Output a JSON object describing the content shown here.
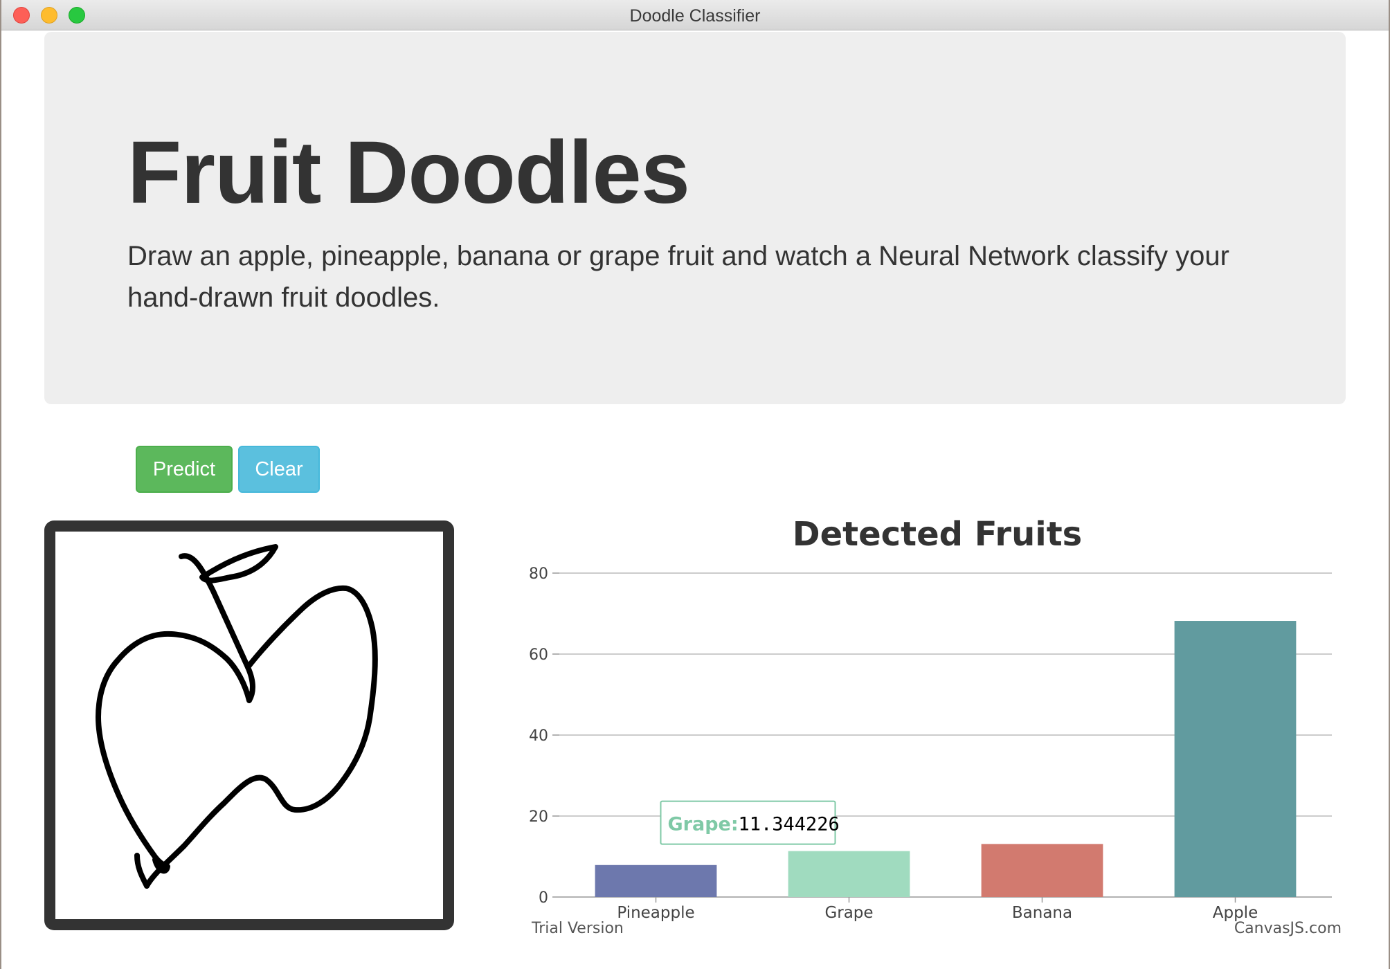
{
  "window": {
    "title": "Doodle Classifier"
  },
  "hero": {
    "title": "Fruit Doodles",
    "lead": "Draw an apple, pineapple, banana or grape fruit and watch a Neural Network classify your hand-drawn fruit doodles."
  },
  "buttons": {
    "predict_label": "Predict",
    "clear_label": "Clear"
  },
  "colors": {
    "predict": "#5cb85c",
    "clear": "#5bc0de",
    "jumbotron_bg": "#eeeeee"
  },
  "canvas": {
    "drawing": "apple doodle"
  },
  "chart_data": {
    "type": "bar",
    "title": "Detected Fruits",
    "categories": [
      "Pineapple",
      "Grape",
      "Banana",
      "Apple"
    ],
    "values": [
      7.9,
      11.344226,
      13.1,
      68.2
    ],
    "colors": [
      "#6d78ad",
      "#a0dbbf",
      "#d27a6f",
      "#619b9f"
    ],
    "ylim": [
      0,
      80
    ],
    "yticks": [
      0,
      20,
      40,
      60,
      80
    ],
    "grid": true,
    "tooltip": {
      "category": "Grape",
      "label": "Grape:",
      "value": "11.344226"
    },
    "watermark_left": "Trial Version",
    "watermark_right": "CanvasJS.com"
  }
}
